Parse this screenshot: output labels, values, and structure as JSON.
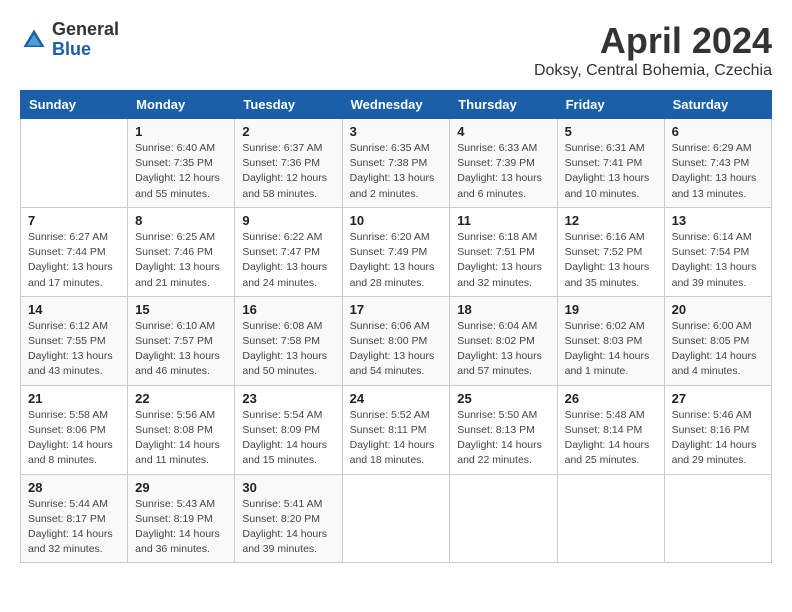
{
  "logo": {
    "general": "General",
    "blue": "Blue"
  },
  "title": "April 2024",
  "location": "Doksy, Central Bohemia, Czechia",
  "days_header": [
    "Sunday",
    "Monday",
    "Tuesday",
    "Wednesday",
    "Thursday",
    "Friday",
    "Saturday"
  ],
  "weeks": [
    [
      {
        "day": "",
        "info": ""
      },
      {
        "day": "1",
        "info": "Sunrise: 6:40 AM\nSunset: 7:35 PM\nDaylight: 12 hours\nand 55 minutes."
      },
      {
        "day": "2",
        "info": "Sunrise: 6:37 AM\nSunset: 7:36 PM\nDaylight: 12 hours\nand 58 minutes."
      },
      {
        "day": "3",
        "info": "Sunrise: 6:35 AM\nSunset: 7:38 PM\nDaylight: 13 hours\nand 2 minutes."
      },
      {
        "day": "4",
        "info": "Sunrise: 6:33 AM\nSunset: 7:39 PM\nDaylight: 13 hours\nand 6 minutes."
      },
      {
        "day": "5",
        "info": "Sunrise: 6:31 AM\nSunset: 7:41 PM\nDaylight: 13 hours\nand 10 minutes."
      },
      {
        "day": "6",
        "info": "Sunrise: 6:29 AM\nSunset: 7:43 PM\nDaylight: 13 hours\nand 13 minutes."
      }
    ],
    [
      {
        "day": "7",
        "info": "Sunrise: 6:27 AM\nSunset: 7:44 PM\nDaylight: 13 hours\nand 17 minutes."
      },
      {
        "day": "8",
        "info": "Sunrise: 6:25 AM\nSunset: 7:46 PM\nDaylight: 13 hours\nand 21 minutes."
      },
      {
        "day": "9",
        "info": "Sunrise: 6:22 AM\nSunset: 7:47 PM\nDaylight: 13 hours\nand 24 minutes."
      },
      {
        "day": "10",
        "info": "Sunrise: 6:20 AM\nSunset: 7:49 PM\nDaylight: 13 hours\nand 28 minutes."
      },
      {
        "day": "11",
        "info": "Sunrise: 6:18 AM\nSunset: 7:51 PM\nDaylight: 13 hours\nand 32 minutes."
      },
      {
        "day": "12",
        "info": "Sunrise: 6:16 AM\nSunset: 7:52 PM\nDaylight: 13 hours\nand 35 minutes."
      },
      {
        "day": "13",
        "info": "Sunrise: 6:14 AM\nSunset: 7:54 PM\nDaylight: 13 hours\nand 39 minutes."
      }
    ],
    [
      {
        "day": "14",
        "info": "Sunrise: 6:12 AM\nSunset: 7:55 PM\nDaylight: 13 hours\nand 43 minutes."
      },
      {
        "day": "15",
        "info": "Sunrise: 6:10 AM\nSunset: 7:57 PM\nDaylight: 13 hours\nand 46 minutes."
      },
      {
        "day": "16",
        "info": "Sunrise: 6:08 AM\nSunset: 7:58 PM\nDaylight: 13 hours\nand 50 minutes."
      },
      {
        "day": "17",
        "info": "Sunrise: 6:06 AM\nSunset: 8:00 PM\nDaylight: 13 hours\nand 54 minutes."
      },
      {
        "day": "18",
        "info": "Sunrise: 6:04 AM\nSunset: 8:02 PM\nDaylight: 13 hours\nand 57 minutes."
      },
      {
        "day": "19",
        "info": "Sunrise: 6:02 AM\nSunset: 8:03 PM\nDaylight: 14 hours\nand 1 minute."
      },
      {
        "day": "20",
        "info": "Sunrise: 6:00 AM\nSunset: 8:05 PM\nDaylight: 14 hours\nand 4 minutes."
      }
    ],
    [
      {
        "day": "21",
        "info": "Sunrise: 5:58 AM\nSunset: 8:06 PM\nDaylight: 14 hours\nand 8 minutes."
      },
      {
        "day": "22",
        "info": "Sunrise: 5:56 AM\nSunset: 8:08 PM\nDaylight: 14 hours\nand 11 minutes."
      },
      {
        "day": "23",
        "info": "Sunrise: 5:54 AM\nSunset: 8:09 PM\nDaylight: 14 hours\nand 15 minutes."
      },
      {
        "day": "24",
        "info": "Sunrise: 5:52 AM\nSunset: 8:11 PM\nDaylight: 14 hours\nand 18 minutes."
      },
      {
        "day": "25",
        "info": "Sunrise: 5:50 AM\nSunset: 8:13 PM\nDaylight: 14 hours\nand 22 minutes."
      },
      {
        "day": "26",
        "info": "Sunrise: 5:48 AM\nSunset: 8:14 PM\nDaylight: 14 hours\nand 25 minutes."
      },
      {
        "day": "27",
        "info": "Sunrise: 5:46 AM\nSunset: 8:16 PM\nDaylight: 14 hours\nand 29 minutes."
      }
    ],
    [
      {
        "day": "28",
        "info": "Sunrise: 5:44 AM\nSunset: 8:17 PM\nDaylight: 14 hours\nand 32 minutes."
      },
      {
        "day": "29",
        "info": "Sunrise: 5:43 AM\nSunset: 8:19 PM\nDaylight: 14 hours\nand 36 minutes."
      },
      {
        "day": "30",
        "info": "Sunrise: 5:41 AM\nSunset: 8:20 PM\nDaylight: 14 hours\nand 39 minutes."
      },
      {
        "day": "",
        "info": ""
      },
      {
        "day": "",
        "info": ""
      },
      {
        "day": "",
        "info": ""
      },
      {
        "day": "",
        "info": ""
      }
    ]
  ]
}
